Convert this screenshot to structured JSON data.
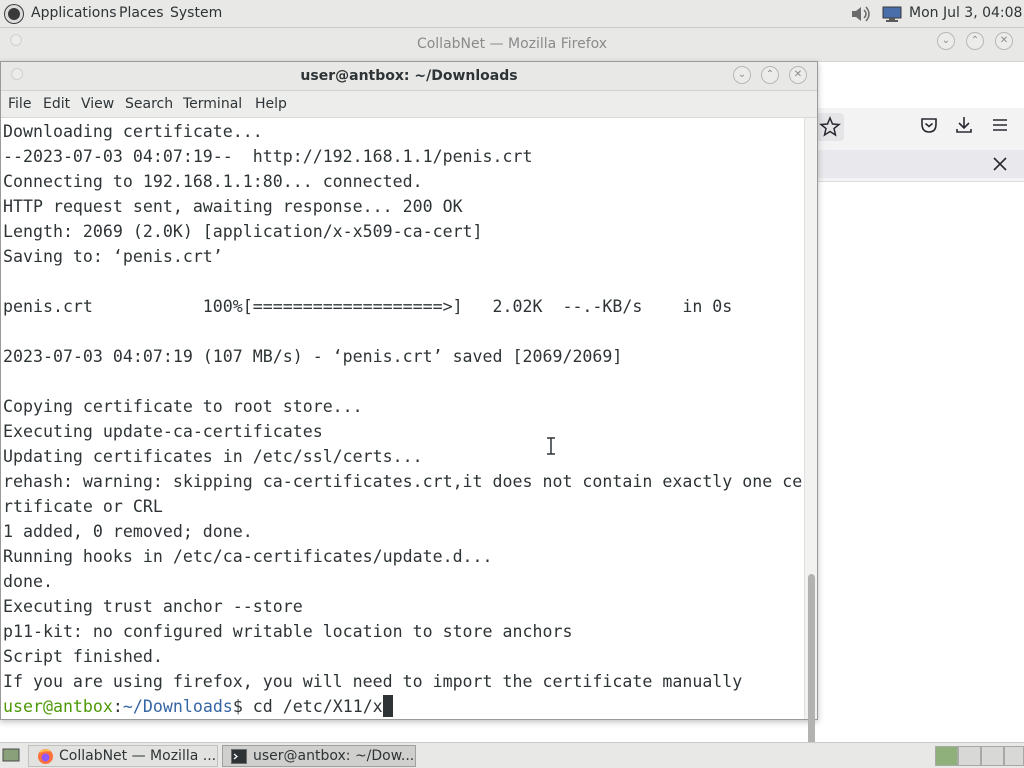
{
  "top_panel": {
    "menus": [
      "Applications",
      "Places",
      "System"
    ],
    "clock": "Mon Jul 3, 04:08"
  },
  "firefox": {
    "title": "CollabNet — Mozilla Firefox"
  },
  "terminal": {
    "title": "user@antbox: ~/Downloads",
    "menu": [
      "File",
      "Edit",
      "View",
      "Search",
      "Terminal",
      "Help"
    ],
    "lines": [
      "Downloading certificate...",
      "--2023-07-03 04:07:19--  http://192.168.1.1/penis.crt",
      "Connecting to 192.168.1.1:80... connected.",
      "HTTP request sent, awaiting response... 200 OK",
      "Length: 2069 (2.0K) [application/x-x509-ca-cert]",
      "Saving to: ‘penis.crt’",
      "",
      "penis.crt           100%[===================>]   2.02K  --.-KB/s    in 0s",
      "",
      "2023-07-03 04:07:19 (107 MB/s) - ‘penis.crt’ saved [2069/2069]",
      "",
      "Copying certificate to root store...",
      "Executing update-ca-certificates",
      "Updating certificates in /etc/ssl/certs...",
      "rehash: warning: skipping ca-certificates.crt,it does not contain exactly one ce",
      "rtificate or CRL",
      "1 added, 0 removed; done.",
      "Running hooks in /etc/ca-certificates/update.d...",
      "done.",
      "Executing trust anchor --store",
      "p11-kit: no configured writable location to store anchors",
      "Script finished.",
      "If you are using firefox, you will need to import the certificate manually"
    ],
    "prompt": {
      "user_host": "user@antbox",
      "separator": ":",
      "path": "~/Downloads",
      "symbol": "$",
      "command": " cd /etc/X11/x"
    }
  },
  "taskbar": {
    "tasks": [
      {
        "label": "CollabNet — Mozilla ...",
        "icon": "firefox-icon"
      },
      {
        "label": "user@antbox: ~/Dow...",
        "icon": "terminal-icon"
      }
    ]
  }
}
